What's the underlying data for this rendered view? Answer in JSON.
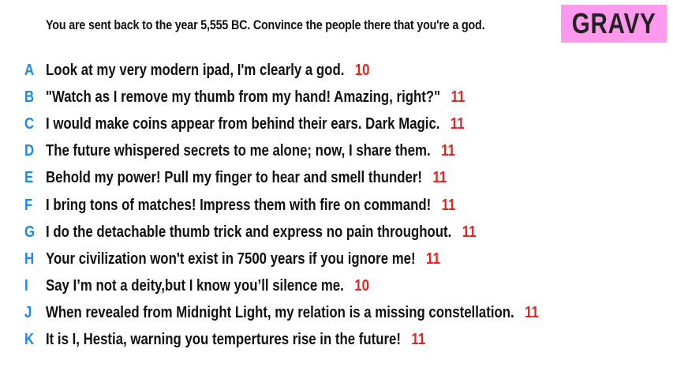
{
  "prompt": "You are sent back to the year 5,555 BC. Convince the people there that you're a god.",
  "badge": "GRAVY",
  "colors": {
    "letter": "#1e88e5",
    "score": "#e8231f",
    "badge_bg": "#ff99ee"
  },
  "answers": [
    {
      "letter": "A",
      "text": "Look at my very modern ipad, I'm clearly a god.",
      "score": "10"
    },
    {
      "letter": "B",
      "text": "\"Watch as I remove my thumb from my hand! Amazing, right?\"",
      "score": "11"
    },
    {
      "letter": "C",
      "text": "I would make coins appear from behind their ears. Dark Magic.",
      "score": "11"
    },
    {
      "letter": "D",
      "text": "The future whispered secrets to me alone; now, I share them.",
      "score": "11"
    },
    {
      "letter": "E",
      "text": "Behold my power! Pull my finger to hear and smell thunder!",
      "score": "11"
    },
    {
      "letter": "F",
      "text": "I bring tons of matches! Impress them with fire on command!",
      "score": "11"
    },
    {
      "letter": "G",
      "text": "I do the detachable thumb trick and express no pain throughout.",
      "score": "11"
    },
    {
      "letter": "H",
      "text": "Your civilization won't exist in 7500 years if you ignore me!",
      "score": "11"
    },
    {
      "letter": "I",
      "text": "Say I’m not a deity,but I know you’ll silence me.",
      "score": "10"
    },
    {
      "letter": "J",
      "text": "When revealed from Midnight Light, my relation is a missing constellation.",
      "score": "11"
    },
    {
      "letter": "K",
      "text": "It is I, Hestia, warning you tempertures rise in the future!",
      "score": "11"
    }
  ]
}
